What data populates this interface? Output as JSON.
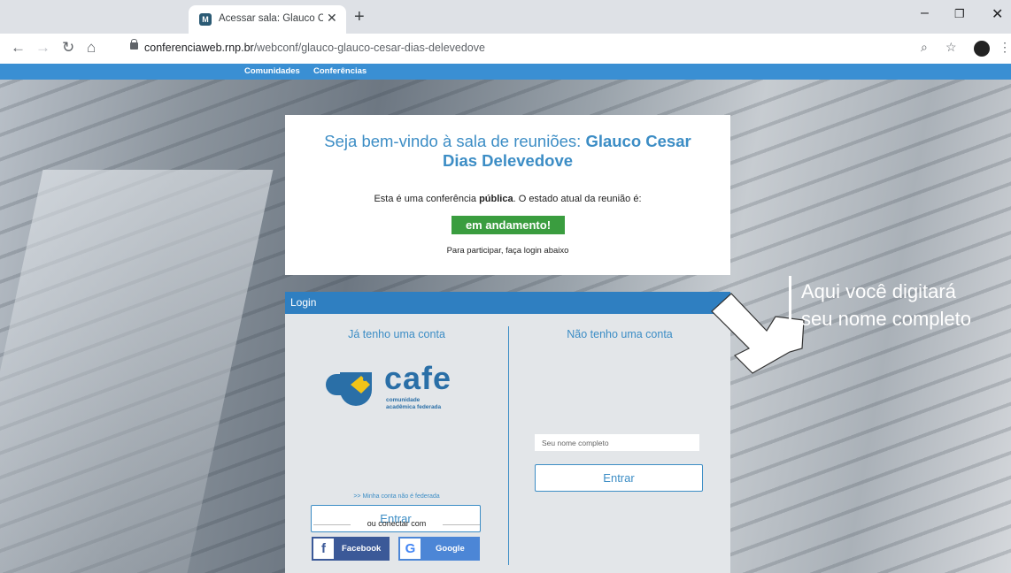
{
  "browser": {
    "tab_title": "Acessar sala: Glauco Cesar Dias D",
    "tab_favicon": "M",
    "url_host": "conferenciaweb.rnp.br",
    "url_path": "/webconf/glauco-glauco-cesar-dias-delevedove"
  },
  "topnav": {
    "items": [
      "Comunidades",
      "Conferências"
    ]
  },
  "welcome": {
    "prefix": "Seja bem-vindo à sala de reuniões: ",
    "room_name": "Glauco Cesar Dias Delevedove"
  },
  "status_line": {
    "before": "Esta é uma conferência ",
    "bold": "pública",
    "after": ". O estado atual da reunião é:"
  },
  "status_badge": "em andamento!",
  "hint": "Para participar, faça login abaixo",
  "login": {
    "header": "Login",
    "left": {
      "title": "Já tenho uma conta",
      "logo_word": "cafe",
      "logo_sub1": "comunidade",
      "logo_sub2": "acadêmica federada",
      "enter_button": "Entrar",
      "non_federated_link": ">> Minha conta não é federada",
      "or_connect": "ou conectar com",
      "facebook_label": "Facebook",
      "google_label": "Google"
    },
    "right": {
      "title": "Não tenho uma conta",
      "name_placeholder": "Seu nome completo",
      "enter_button": "Entrar"
    }
  },
  "annotation": {
    "line1": "Aqui você digitará",
    "line2": "seu nome completo"
  },
  "colors": {
    "accent": "#3c8dc5",
    "status_green": "#3a9d3f",
    "header_blue": "#2f7fc1",
    "facebook": "#3b5998",
    "google": "#4c86d6"
  }
}
